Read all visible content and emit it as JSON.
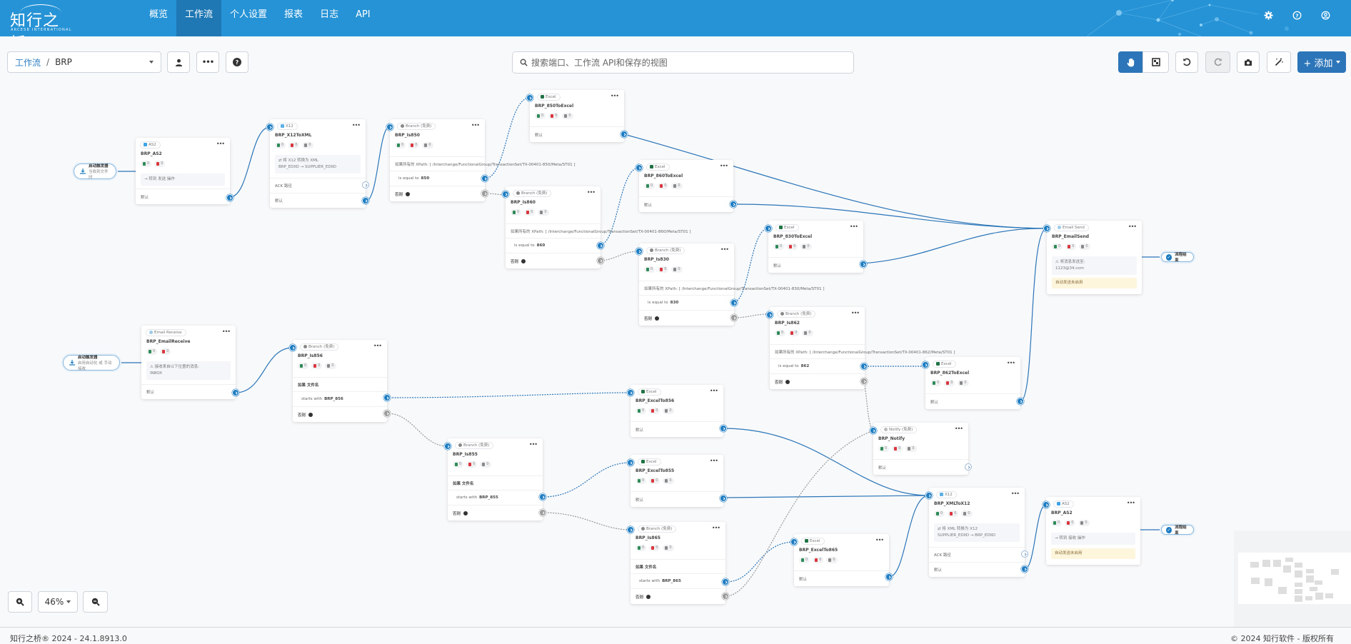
{
  "app": {
    "logo_cn": "知行之桥",
    "logo_en": "ARCESB INTERNATIONAL",
    "nav": [
      "概览",
      "工作流",
      "个人设置",
      "报表",
      "日志",
      "API"
    ],
    "active_nav": "工作流",
    "top_icons": [
      "gear-icon",
      "help-icon",
      "user-icon"
    ]
  },
  "toolbar": {
    "breadcrumb_root": "工作流",
    "breadcrumb_sep": "/",
    "breadcrumb_current": "BRP",
    "search_placeholder": "搜索端口、工作流 API和保存的视图",
    "add_label": "+ 添加",
    "right_buttons": [
      "pan-hand-icon",
      "select-box-icon",
      "undo-icon",
      "redo-icon",
      "camera-icon",
      "magic-wand-icon"
    ],
    "left_buttons": [
      "user-icon",
      "more-icon",
      "help-icon"
    ]
  },
  "triggers": [
    {
      "title": "启动触发器",
      "subtitle": "当收到文件时"
    },
    {
      "title": "启动触发器",
      "subtitle": "启用自动化 或 手动接收"
    }
  ],
  "end_label": "流程结束",
  "nodes": {
    "as2_in": {
      "type": "AS2",
      "name": "BRP_AS2",
      "counts": [
        0,
        0
      ],
      "info": "→ 转到 发送 操作",
      "out": "默认"
    },
    "x12toxml": {
      "type": "X12",
      "name": "BRP_X12ToXML",
      "counts": [
        0,
        0,
        0
      ],
      "info1": "⇄ 将 X12 转换为 XML",
      "info2": "BRP_EDIID → SUPPLIER_EDIID",
      "ack": "ACK 路径",
      "out": "默认"
    },
    "is850": {
      "type": "Branch (免费)",
      "name": "BRP_Is850",
      "counts": [
        0,
        0,
        0
      ],
      "cond": "如果所有的 XPath: [ /Interchange/FunctionalGroup/TransactionSet/TX-00401-850/Meta/ST01 ]",
      "case": "is equal to",
      "val": "850",
      "else": "否则"
    },
    "850toexcel": {
      "type": "Excel",
      "name": "BRP_850ToExcel",
      "counts": [
        0,
        0,
        0
      ],
      "out": "默认"
    },
    "is860": {
      "type": "Branch (免费)",
      "name": "BRP_Is860",
      "counts": [
        0,
        0,
        0
      ],
      "cond": "如果所有的 XPath: [ /Interchange/FunctionalGroup/TransactionSet/TX-00401-860/Meta/ST01 ]",
      "case": "is equal to",
      "val": "860",
      "else": "否则"
    },
    "860toexcel": {
      "type": "Excel",
      "name": "BRP_860ToExcel",
      "counts": [
        0,
        0,
        0
      ],
      "out": "默认"
    },
    "is830": {
      "type": "Branch (免费)",
      "name": "BRP_Is830",
      "counts": [
        0,
        0,
        0
      ],
      "cond": "如果所有的 XPath: [ /Interchange/FunctionalGroup/TransactionSet/TX-00401-830/Meta/ST01 ]",
      "case": "is equal to",
      "val": "830",
      "else": "否则"
    },
    "830toexcel": {
      "type": "Excel",
      "name": "BRP_830ToExcel",
      "counts": [
        0,
        0,
        0
      ],
      "out": "默认"
    },
    "is862": {
      "type": "Branch (免费)",
      "name": "BRP_Is862",
      "counts": [
        0,
        0,
        0
      ],
      "cond": "如果所有的 XPath: [ /Interchange/FunctionalGroup/TransactionSet/TX-00401-862/Meta/ST01 ]",
      "case": "is equal to",
      "val": "862",
      "else": "否则"
    },
    "862toexcel": {
      "type": "Excel",
      "name": "BRP_862ToExcel",
      "counts": [
        0,
        0,
        0
      ],
      "out": "默认"
    },
    "emailsend": {
      "type": "Email Send",
      "name": "BRP_EmailSend",
      "counts": [
        0,
        0,
        0
      ],
      "info1": "⚠ 将消息发送至:",
      "info2": "1123@34.com",
      "warn": "自动发送未启用"
    },
    "emailrecv": {
      "type": "Email Receive",
      "name": "BRP_EmailReceive",
      "counts": [
        0,
        0
      ],
      "info1": "⚠ 接收来自以下位置的消息:",
      "info2": "INBOX",
      "out": "默认"
    },
    "is856": {
      "type": "Branch (免费)",
      "name": "BRP_Is856",
      "counts": [
        0,
        0,
        0
      ],
      "cond": "如果 文件名",
      "case": "starts with",
      "val": "BRP_856",
      "else": "否则"
    },
    "exceltoxx856": {
      "type": "Excel",
      "name": "BRP_ExcelTo856",
      "counts": [
        0,
        0,
        0
      ],
      "out": "默认"
    },
    "is855": {
      "type": "Branch (免费)",
      "name": "BRP_Is855",
      "counts": [
        0,
        0,
        0
      ],
      "cond": "如果 文件名",
      "case": "starts with",
      "val": "BRP_855",
      "else": "否则"
    },
    "exceltoxx855": {
      "type": "Excel",
      "name": "BRP_ExcelTo855",
      "counts": [
        0,
        0,
        0
      ],
      "out": "默认"
    },
    "is865": {
      "type": "Branch (免费)",
      "name": "BRP_Is865",
      "counts": [
        0,
        0,
        0
      ],
      "cond": "如果 文件名",
      "case": "starts with",
      "val": "BRP_865",
      "else": "否则"
    },
    "exceltoxx865": {
      "type": "Excel",
      "name": "BRP_ExcelTo865",
      "counts": [
        0,
        0,
        0
      ],
      "out": "默认"
    },
    "notify": {
      "type": "Notify (免费)",
      "name": "BRP_Notify",
      "counts": [
        0,
        0,
        0
      ],
      "out": "默认"
    },
    "xmltox12": {
      "type": "X12",
      "name": "BRP_XMLToX12",
      "counts": [
        0,
        0,
        0
      ],
      "info1": "⇄ 将 XML 转换为 X12",
      "info2": "SUPPLIER_EDIID → BRP_EDIID",
      "ack": "ACK 路径",
      "out": "默认"
    },
    "as2_out": {
      "type": "AS2",
      "name": "BRP_AS2",
      "counts": [
        0,
        0,
        0
      ],
      "info": "→ 转到 接收 操作",
      "warn": "自动发送未启用"
    }
  },
  "zoom": {
    "level": "46%"
  },
  "footer": {
    "left": "知行之桥® 2024 - 24.1.8913.0",
    "right": "© 2024 知行软件 - 版权所有"
  },
  "colors": {
    "header": "#2593d6",
    "active_nav": "#1f78b4",
    "port": "#1d7cc1",
    "link": "#2b75b8",
    "primary_button": "#2b75b8"
  }
}
